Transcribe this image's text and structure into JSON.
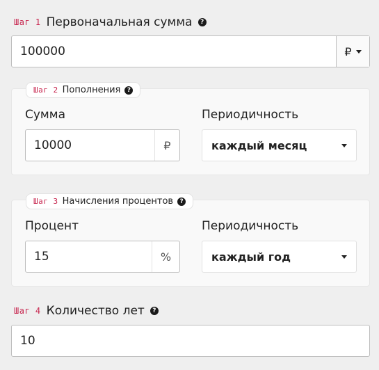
{
  "step1": {
    "tag": "Шаг 1",
    "title": "Первоначальная сумма",
    "amount": "100000",
    "currency": "₽"
  },
  "step2": {
    "tag": "Шаг 2",
    "title": "Пополнения",
    "sum_label": "Сумма",
    "sum_value": "10000",
    "sum_unit": "₽",
    "period_label": "Периодичность",
    "period_value": "каждый месяц"
  },
  "step3": {
    "tag": "Шаг 3",
    "title": "Начисления процентов",
    "rate_label": "Процент",
    "rate_value": "15",
    "rate_unit": "%",
    "period_label": "Периодичность",
    "period_value": "каждый год"
  },
  "step4": {
    "tag": "Шаг 4",
    "title": "Количество лет",
    "years": "10"
  },
  "icons": {
    "help": "?"
  },
  "colors": {
    "step_tag": "#c7254e",
    "background": "#efefef",
    "panel": "#f9f9f9"
  }
}
